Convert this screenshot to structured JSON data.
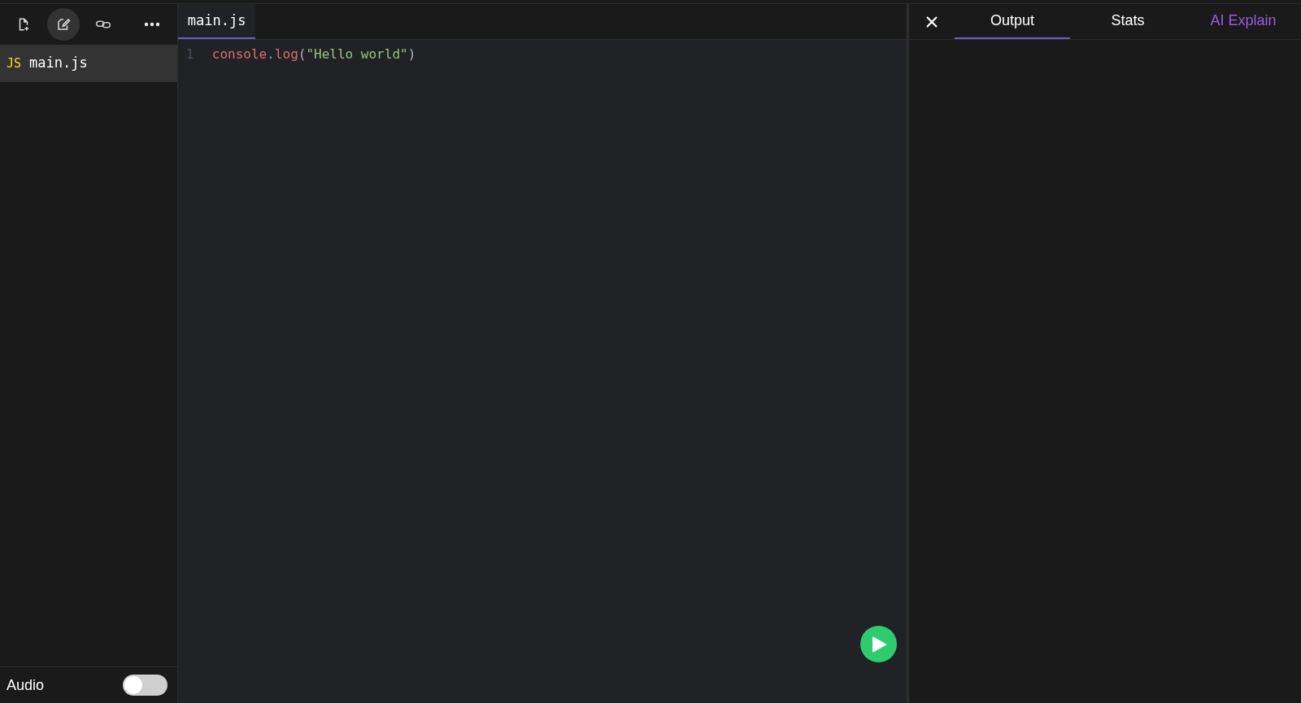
{
  "sidebar": {
    "files": [
      {
        "badge": "JS",
        "name": "main.js",
        "selected": true
      }
    ],
    "audio": {
      "label": "Audio",
      "on": false
    }
  },
  "editor": {
    "tabs": [
      {
        "label": "main.js",
        "selected": true
      }
    ],
    "lines": [
      {
        "number": "1",
        "tokens": [
          {
            "kind": "ident",
            "text": "console"
          },
          {
            "kind": "punct",
            "text": "."
          },
          {
            "kind": "ident",
            "text": "log"
          },
          {
            "kind": "paren",
            "text": "("
          },
          {
            "kind": "string",
            "text": "\"Hello world\""
          },
          {
            "kind": "paren",
            "text": ")"
          }
        ]
      }
    ]
  },
  "output": {
    "tabs": [
      {
        "label": "Output",
        "selected": true,
        "color": "#ffffff"
      },
      {
        "label": "Stats",
        "selected": false,
        "color": "#ffffff"
      },
      {
        "label": "AI Explain",
        "selected": false,
        "color": "#9b5de5"
      }
    ]
  }
}
